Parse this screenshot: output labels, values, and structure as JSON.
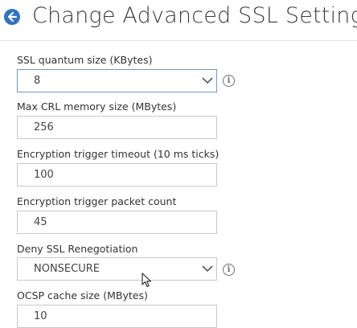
{
  "header": {
    "title": "Change Advanced SSL Settings"
  },
  "fields": [
    {
      "label": "SSL quantum size (KBytes)",
      "value": "8",
      "type": "select"
    },
    {
      "label": "Max CRL memory size (MBytes)",
      "value": "256",
      "type": "input"
    },
    {
      "label": "Encryption trigger timeout (10 ms ticks)",
      "value": "100",
      "type": "input"
    },
    {
      "label": "Encryption trigger packet count",
      "value": "45",
      "type": "input"
    },
    {
      "label": "Deny SSL Renegotiation",
      "value": "NONSECURE",
      "type": "select"
    },
    {
      "label": "OCSP cache size (MBytes)",
      "value": "10",
      "type": "input"
    }
  ],
  "icons": {
    "back": "back-arrow-icon",
    "info": "info-icon",
    "chevron": "chevron-down-icon",
    "cursor": "mouse-pointer-icon"
  },
  "colors": {
    "accent": "#2f73c4",
    "focus_border": "#6c97c7"
  }
}
